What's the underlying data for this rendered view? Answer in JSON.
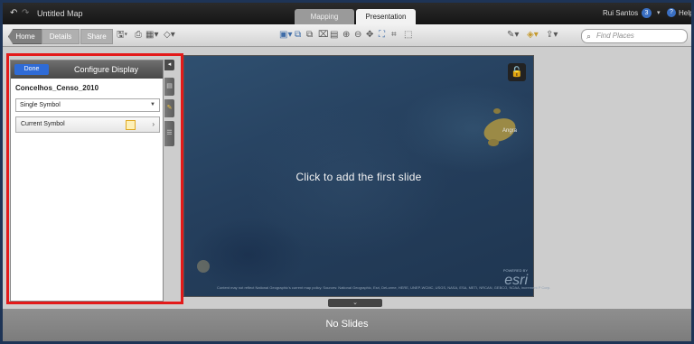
{
  "titlebar": {
    "title": "Untitled Map",
    "undo_icon": "↶",
    "redo_icon": "↷",
    "tabs": [
      {
        "label": "Mapping",
        "active": false
      },
      {
        "label": "Presentation",
        "active": true
      }
    ],
    "user_name": "Rui Santos",
    "user_badge": "3",
    "help_label": "Help"
  },
  "toolbar": {
    "home_label": "Home",
    "details_label": "Details",
    "share_label": "Share",
    "find_placeholder": "Find Places"
  },
  "panel": {
    "done_label": "Done",
    "title": "Configure Display",
    "layer_name": "Concelhos_Censo_2010",
    "symbology_value": "Single Symbol",
    "current_symbol_label": "Current Symbol",
    "symbol_fill_color": "#fdf0b8",
    "symbol_outline_color": "#e0a923"
  },
  "map": {
    "prompt": "Click to add the first slide",
    "place_label": "Angra",
    "attribution": "Content may not reflect National Geographic's current map policy. Sources: National Geographic, Esri, DeLorme, HERE, UNEP-WCMC, USGS, NASA, ESA, METI, NRCAN, GEBCO, NOAA, increment P Corp.",
    "logo": "esri",
    "logo_caption": "POWERED BY"
  },
  "slides": {
    "empty_label": "No Slides"
  },
  "colors": {
    "highlight": "#e31a1a",
    "done_button": "#2f6bd6"
  }
}
